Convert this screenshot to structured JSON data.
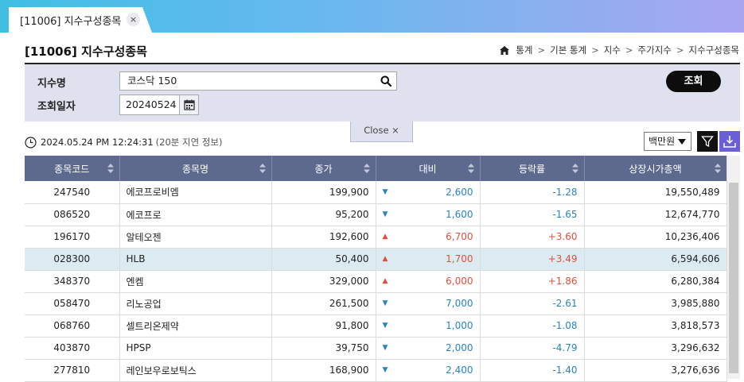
{
  "tab": {
    "label": "[11006] 지수구성종목",
    "close": "×"
  },
  "page": {
    "title": "[11006] 지수구성종목"
  },
  "breadcrumb": [
    "통계",
    "기본 통계",
    "지수",
    "주가지수",
    "지수구성종목"
  ],
  "search": {
    "index_label": "지수명",
    "index_value": "코스닥 150",
    "date_label": "조회일자",
    "date_value": "20240524",
    "query_button": "조회"
  },
  "close_panel": "Close ×",
  "timestamp": {
    "time": "2024.05.24 PM 12:24:31",
    "delay": "(20분 지연 정보)"
  },
  "unit": "백만원",
  "columns": [
    "종목코드",
    "종목명",
    "종가",
    "대비",
    "등락률",
    "상장시가총액"
  ],
  "rows": [
    {
      "code": "247540",
      "name": "에코프로비엠",
      "close": "199,900",
      "dir": "down",
      "change": "2,600",
      "rate": "-1.28",
      "cap": "19,550,489"
    },
    {
      "code": "086520",
      "name": "에코프로",
      "close": "95,200",
      "dir": "down",
      "change": "1,600",
      "rate": "-1.65",
      "cap": "12,674,770"
    },
    {
      "code": "196170",
      "name": "알테오젠",
      "close": "192,600",
      "dir": "up",
      "change": "6,700",
      "rate": "+3.60",
      "cap": "10,236,406"
    },
    {
      "code": "028300",
      "name": "HLB",
      "close": "50,400",
      "dir": "up",
      "change": "1,700",
      "rate": "+3.49",
      "cap": "6,594,606"
    },
    {
      "code": "348370",
      "name": "엔켐",
      "close": "329,000",
      "dir": "up",
      "change": "6,000",
      "rate": "+1.86",
      "cap": "6,280,384"
    },
    {
      "code": "058470",
      "name": "리노공업",
      "close": "261,500",
      "dir": "down",
      "change": "7,000",
      "rate": "-2.61",
      "cap": "3,985,880"
    },
    {
      "code": "068760",
      "name": "셀트리온제약",
      "close": "91,800",
      "dir": "down",
      "change": "1,000",
      "rate": "-1.08",
      "cap": "3,818,573"
    },
    {
      "code": "403870",
      "name": "HPSP",
      "close": "39,750",
      "dir": "down",
      "change": "2,000",
      "rate": "-4.79",
      "cap": "3,296,632"
    },
    {
      "code": "277810",
      "name": "레인보우로보틱스",
      "close": "168,900",
      "dir": "down",
      "change": "2,400",
      "rate": "-1.40",
      "cap": "3,276,636"
    }
  ],
  "colors": {
    "header_bg": "#5d6a8e",
    "up": "#e0503c",
    "down": "#2a82c6",
    "selected_row": "#dcebf2"
  }
}
